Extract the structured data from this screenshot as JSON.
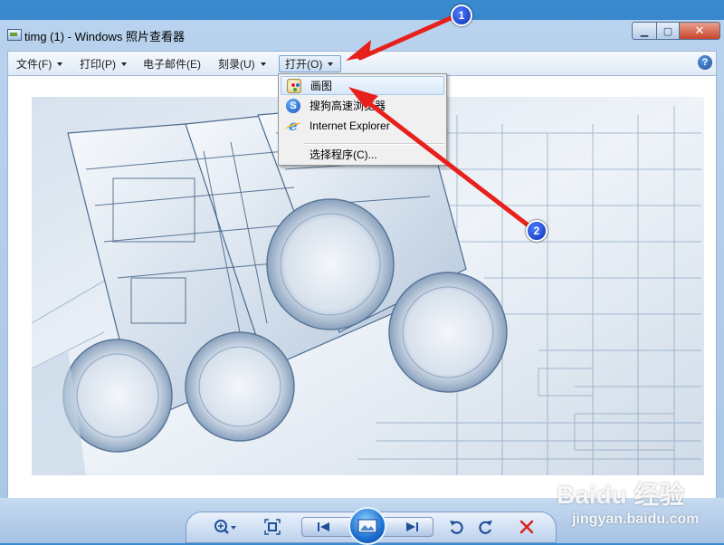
{
  "window": {
    "title": "timg (1) - Windows 照片查看器",
    "minimize_glyph": "▁",
    "maximize_glyph": "▢",
    "close_glyph": "✕"
  },
  "menu": {
    "items": [
      {
        "label": "文件(F)",
        "has_caret": true
      },
      {
        "label": "打印(P)",
        "has_caret": true
      },
      {
        "label": "电子邮件(E)",
        "has_caret": false
      },
      {
        "label": "刻录(U)",
        "has_caret": true
      },
      {
        "label": "打开(O)",
        "has_caret": true,
        "active": true
      }
    ],
    "help_label": "?"
  },
  "dropdown": {
    "items": [
      {
        "label": "画图",
        "icon": "paint-icon"
      },
      {
        "label": "搜狗高速浏览器",
        "icon": "sogou-icon"
      },
      {
        "label": "Internet Explorer",
        "icon": "ie-icon"
      }
    ],
    "choose_program_label": "选择程序(C)..."
  },
  "annotations": {
    "badge_1": "1",
    "badge_2": "2",
    "arrow_color": "#e8201c"
  },
  "toolbar": {
    "icons": [
      "zoom-icon",
      "fit-icon",
      "previous-icon",
      "slideshow-icon",
      "next-icon",
      "rotate-left-icon",
      "rotate-right-icon",
      "delete-icon"
    ]
  },
  "watermark": {
    "brand": "Baidu 经验",
    "url": "jingyan.baidu.com"
  }
}
